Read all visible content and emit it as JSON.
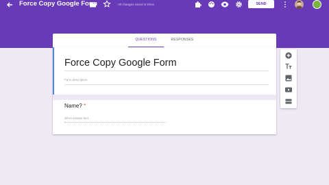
{
  "header": {
    "title": "Force Copy Google Form",
    "save_status": "All changes saved in Drive",
    "send_label": "SEND",
    "icons": [
      "back-arrow-icon",
      "folder-icon",
      "star-icon",
      "addon-icon",
      "palette-icon",
      "preview-eye-icon",
      "settings-gear-icon",
      "more-vert-icon",
      "avatar",
      "help-avatar"
    ],
    "accent_color": "#673ab7"
  },
  "tabs": {
    "questions": "QUESTIONS",
    "responses": "RESPONSES",
    "active": "QUESTIONS"
  },
  "form": {
    "title": "Force Copy Google Form",
    "description_placeholder": "Form description",
    "question": {
      "label": "Name?",
      "required_marker": "*",
      "answer_placeholder": "Short answer text"
    }
  },
  "toolbar": {
    "icons": [
      "add-question-icon",
      "add-title-icon",
      "add-image-icon",
      "add-video-icon",
      "add-section-icon"
    ]
  },
  "colors": {
    "header": "#673ab7",
    "background": "#efe8f5",
    "title_accent": "#4285f4",
    "required": "#db4437"
  }
}
